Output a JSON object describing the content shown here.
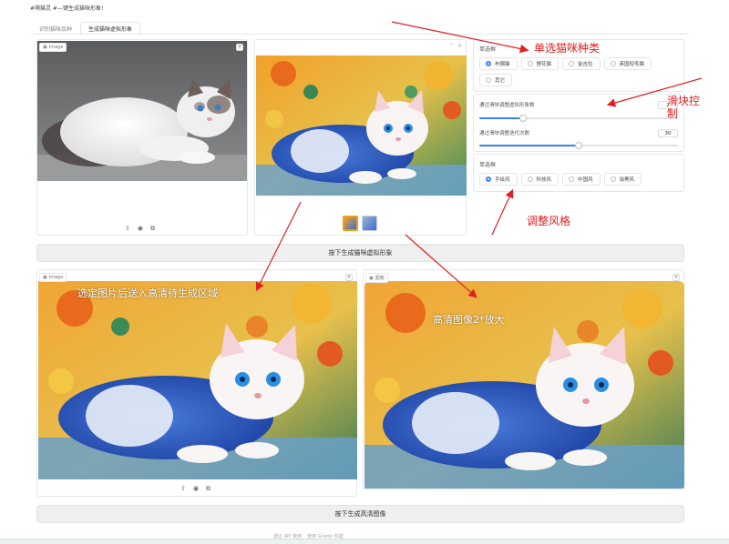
{
  "app": {
    "title": "#萌猫灵 #—键生成猫咪形象!"
  },
  "tabs": [
    {
      "label": "识别猫咪品种",
      "active": false
    },
    {
      "label": "生成猫咪虚拟形象",
      "active": true
    }
  ],
  "input_image": {
    "label": "Image",
    "close": "×"
  },
  "output_image": {
    "close": "×",
    "top_icons": "⌂ ×"
  },
  "thumbnails_count": 2,
  "toolbar_icons": {
    "upload": "⇧",
    "webcam": "◉",
    "clipboard": "⧉"
  },
  "breed_select": {
    "label": "单选框",
    "options": [
      "布偶猫",
      "狸花猫",
      "金吉拉",
      "英国短毛猫",
      "其它"
    ],
    "selected_index": 0
  },
  "sliders": [
    {
      "label": "通过滑块调整虚拟形象数",
      "value": "2",
      "fraction": 0.09
    },
    {
      "label": "通过滑块调整迭代次数",
      "value": "30",
      "fraction": 0.5
    }
  ],
  "style_select": {
    "label": "单选框",
    "options": [
      "手绘风",
      "科技风",
      "中国风",
      "浊黑风"
    ],
    "selected_index": 0
  },
  "generate_button": {
    "label": "按下生成猫咪虚拟形象"
  },
  "selected_image": {
    "label": "Image",
    "close": "×"
  },
  "hd_image": {
    "label": "图像",
    "close": "×"
  },
  "hd_button": {
    "label": "按下生成高清图像"
  },
  "annotations": {
    "breed": "单选猫咪种类",
    "slider": "滑块控\n制",
    "style": "调整风格",
    "select_text": "选定图片后送入高清待生成区域",
    "hd_text": "高清图像2*放大"
  },
  "footer": {
    "left": "通过 API 使用",
    "right": "使用 Gradio 构建"
  },
  "colors": {
    "accent": "#3b82f6",
    "annotation": "#e02020"
  }
}
